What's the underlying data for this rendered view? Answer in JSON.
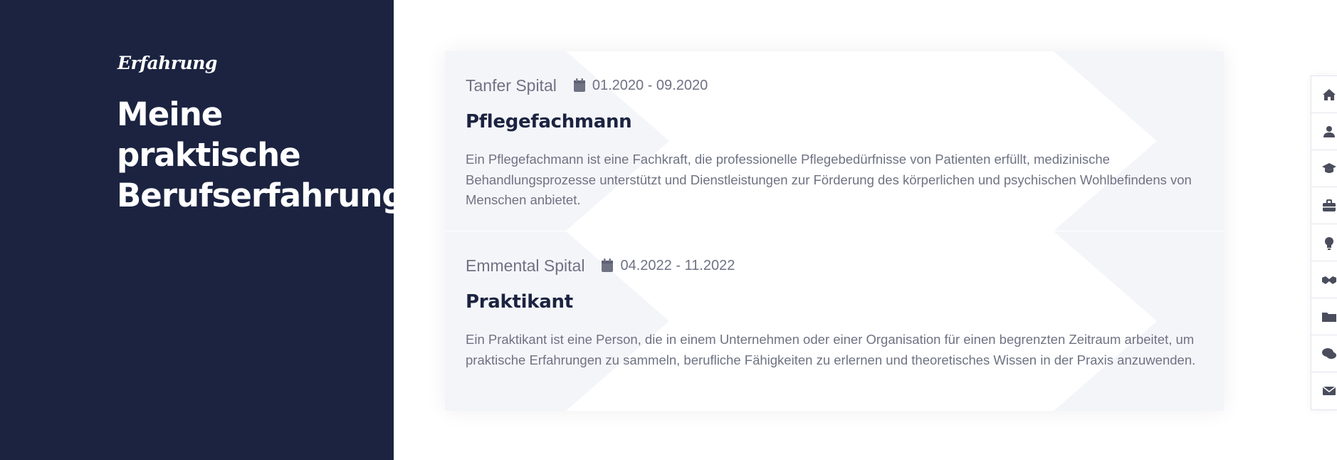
{
  "section": {
    "eyebrow": "Erfahrung",
    "title": "Meine praktische Berufserfahrung"
  },
  "experience": [
    {
      "company": "Tanfer Spital",
      "date_range": "01.2020 - 09.2020",
      "role": "Pflegefachmann",
      "description": "Ein Pflegefachmann ist eine Fachkraft, die professionelle Pflegebedürfnisse von Patienten erfüllt, medizinische Behandlungsprozesse unterstützt und Dienstleistungen zur Förderung des körperlichen und psychischen Wohlbefindens von Menschen anbietet."
    },
    {
      "company": "Emmental Spital",
      "date_range": "04.2022 - 11.2022",
      "role": "Praktikant",
      "description": "Ein Praktikant ist eine Person, die in einem Unternehmen oder einer Organisation für einen begrenzten Zeitraum arbeitet, um praktische Erfahrungen zu sammeln, berufliche Fähigkeiten zu erlernen und theoretisches Wissen in der Praxis anzuwenden."
    }
  ],
  "side_nav": {
    "icons": [
      "home-icon",
      "user-icon",
      "graduation-cap-icon",
      "briefcase-icon",
      "lightbulb-icon",
      "handshake-icon",
      "folder-icon",
      "comments-icon",
      "envelope-icon"
    ]
  },
  "colors": {
    "panel_bg": "#1b2340",
    "card_bg": "#f4f5f9",
    "text_muted": "#6f7283",
    "heading": "#1b2340"
  }
}
